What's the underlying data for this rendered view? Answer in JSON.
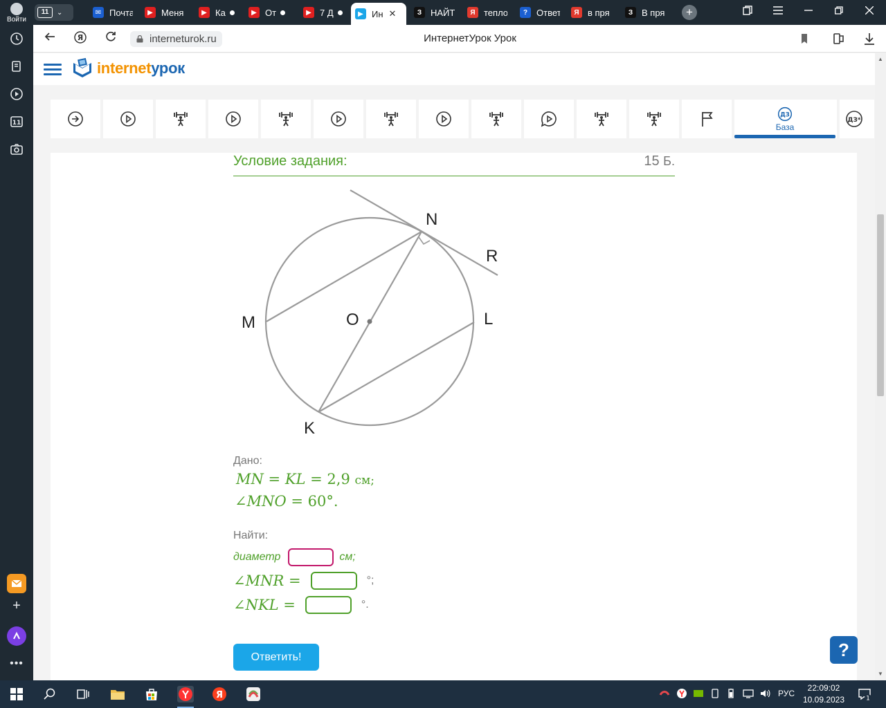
{
  "browser": {
    "login_label": "Войти",
    "tab_count": "11",
    "tabs": [
      {
        "label": "Почта",
        "color": "#1b5fd0",
        "glyph": "✉"
      },
      {
        "label": "Меня",
        "color": "#e02020",
        "glyph": "▶"
      },
      {
        "label": "Ка",
        "color": "#e02020",
        "glyph": "▶"
      },
      {
        "label": "От",
        "color": "#e02020",
        "glyph": "▶"
      },
      {
        "label": "7 Д",
        "color": "#e02020",
        "glyph": "▶"
      },
      {
        "label": "Ин",
        "color": "#1ba6e8",
        "glyph": "▶"
      },
      {
        "label": "НАЙТ",
        "color": "#111111",
        "glyph": "З"
      },
      {
        "label": "тепло",
        "color": "#e23a2e",
        "glyph": "Я"
      },
      {
        "label": "Ответ",
        "color": "#1b5fd0",
        "glyph": "?"
      },
      {
        "label": "в пря",
        "color": "#e23a2e",
        "glyph": "Я"
      },
      {
        "label": "В пря",
        "color": "#111111",
        "glyph": "З"
      }
    ],
    "url": "interneturok.ru",
    "page_title": "ИнтернетУрок Урок",
    "sidebar_count": "11"
  },
  "site": {
    "logo_part1": "internet",
    "logo_part2": "урок",
    "active_step_badge": "ДЗ",
    "active_step_label": "База",
    "last_step_badge": "ДЗ*"
  },
  "task": {
    "condition_title": "Условие задания:",
    "points_value": "15",
    "points_unit": "Б.",
    "figure_labels": {
      "N": "N",
      "R": "R",
      "M": "M",
      "O": "O",
      "L": "L",
      "K": "K"
    },
    "given_label": "Дано:",
    "given_line1_var": "MN = KL = ",
    "given_line1_val": "2,9",
    "given_line1_unit": "см;",
    "given_line2_var": "∠MNO = ",
    "given_line2_val": "60°.",
    "find_label": "Найти:",
    "find_diameter_label": "диаметр",
    "find_diameter_unit": "см;",
    "find_angle1": "∠MNR =",
    "find_angle1_unit": "°;",
    "find_angle2": "∠NKL =",
    "find_angle2_unit": "°.",
    "submit_label": "Ответить!",
    "help_label": "?"
  },
  "taskbar": {
    "lang": "РУС",
    "time": "22:09:02",
    "date": "10.09.2023",
    "notifications": "1"
  },
  "colors": {
    "green": "#4fa02a",
    "blue": "#1b66b1",
    "pink": "#c2186b",
    "submit": "#1ba6e8"
  }
}
